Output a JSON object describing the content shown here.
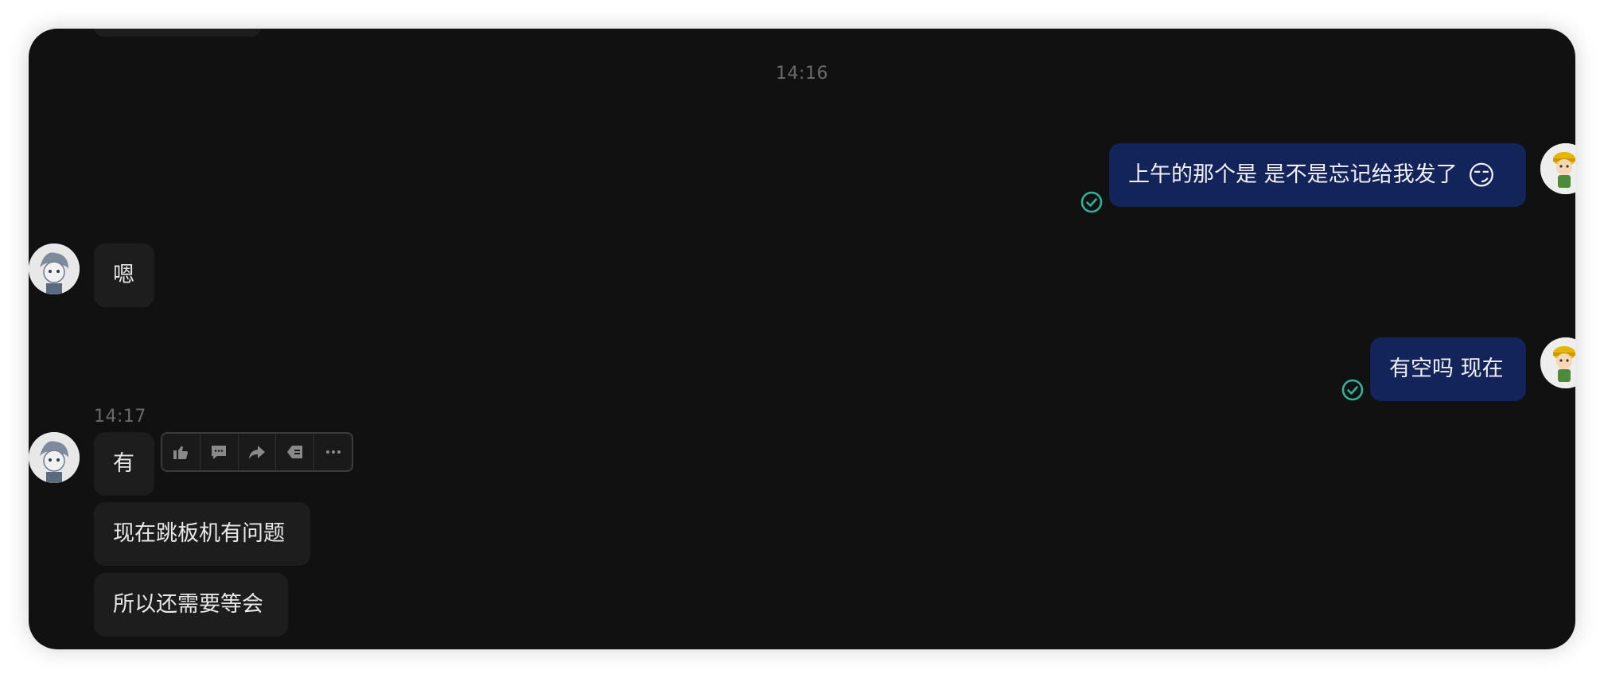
{
  "timestamps": {
    "first": "14:16",
    "second": "14:17"
  },
  "messages": [
    {
      "direction": "outgoing",
      "text": "上午的那个是 是不是忘记给我发了",
      "emoji": "😏",
      "status_icon": "read-check-icon"
    },
    {
      "direction": "incoming",
      "text": "嗯"
    },
    {
      "direction": "outgoing",
      "text": "有空吗 现在",
      "status_icon": "read-check-icon"
    },
    {
      "direction": "incoming",
      "text": "有"
    },
    {
      "direction": "incoming",
      "text": "现在跳板机有问题"
    },
    {
      "direction": "incoming",
      "text": "所以还需要等会"
    }
  ],
  "hover_toolbar": {
    "actions": [
      "thumbs-up-icon",
      "comment-icon",
      "forward-icon",
      "quote-icon",
      "more-icon"
    ]
  },
  "colors": {
    "background": "#111111",
    "incoming_bubble": "#1d1d1d",
    "outgoing_bubble": "#13245a",
    "read_check": "#2fb39a",
    "timestamp": "#6a6a6a"
  }
}
